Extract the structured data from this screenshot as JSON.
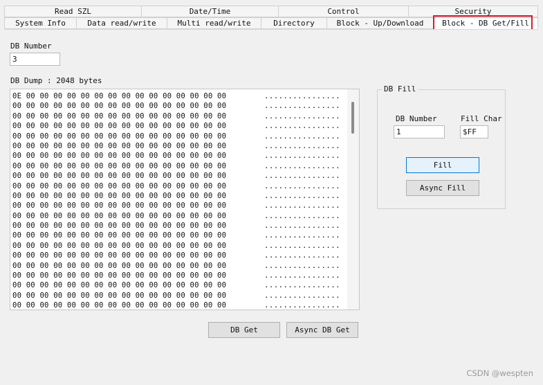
{
  "tabs_top": [
    "Read SZL",
    "Date/Time",
    "Control",
    "Security"
  ],
  "tabs_bottom": [
    "System Info",
    "Data read/write",
    "Multi read/write",
    "Directory",
    "Block - Up/Download",
    "Block - DB Get/Fill"
  ],
  "active_tab": "Block - DB Get/Fill",
  "highlight_color": "#e0162b",
  "db_number": {
    "label": "DB Number",
    "value": "3"
  },
  "dump": {
    "label": "DB Dump : 2048 bytes",
    "lines": [
      {
        "hex": "0E 00 00 00 00 00 00 00 00 00 00 00 00 00 00 00",
        "ascii": "................"
      },
      {
        "hex": "00 00 00 00 00 00 00 00 00 00 00 00 00 00 00 00",
        "ascii": "................"
      },
      {
        "hex": "00 00 00 00 00 00 00 00 00 00 00 00 00 00 00 00",
        "ascii": "................"
      },
      {
        "hex": "00 00 00 00 00 00 00 00 00 00 00 00 00 00 00 00",
        "ascii": "................"
      },
      {
        "hex": "00 00 00 00 00 00 00 00 00 00 00 00 00 00 00 00",
        "ascii": "................"
      },
      {
        "hex": "00 00 00 00 00 00 00 00 00 00 00 00 00 00 00 00",
        "ascii": "................"
      },
      {
        "hex": "00 00 00 00 00 00 00 00 00 00 00 00 00 00 00 00",
        "ascii": "................"
      },
      {
        "hex": "00 00 00 00 00 00 00 00 00 00 00 00 00 00 00 00",
        "ascii": "................"
      },
      {
        "hex": "00 00 00 00 00 00 00 00 00 00 00 00 00 00 00 00",
        "ascii": "................"
      },
      {
        "hex": "00 00 00 00 00 00 00 00 00 00 00 00 00 00 00 00",
        "ascii": "................"
      },
      {
        "hex": "00 00 00 00 00 00 00 00 00 00 00 00 00 00 00 00",
        "ascii": "................"
      },
      {
        "hex": "00 00 00 00 00 00 00 00 00 00 00 00 00 00 00 00",
        "ascii": "................"
      },
      {
        "hex": "00 00 00 00 00 00 00 00 00 00 00 00 00 00 00 00",
        "ascii": "................"
      },
      {
        "hex": "00 00 00 00 00 00 00 00 00 00 00 00 00 00 00 00",
        "ascii": "................"
      },
      {
        "hex": "00 00 00 00 00 00 00 00 00 00 00 00 00 00 00 00",
        "ascii": "................"
      },
      {
        "hex": "00 00 00 00 00 00 00 00 00 00 00 00 00 00 00 00",
        "ascii": "................"
      },
      {
        "hex": "00 00 00 00 00 00 00 00 00 00 00 00 00 00 00 00",
        "ascii": "................"
      },
      {
        "hex": "00 00 00 00 00 00 00 00 00 00 00 00 00 00 00 00",
        "ascii": "................"
      },
      {
        "hex": "00 00 00 00 00 00 00 00 00 00 00 00 00 00 00 00",
        "ascii": "................"
      },
      {
        "hex": "00 00 00 00 00 00 00 00 00 00 00 00 00 00 00 00",
        "ascii": "................"
      },
      {
        "hex": "00 00 00 00 00 00 00 00 00 00 00 00 00 00 00 00",
        "ascii": "................"
      },
      {
        "hex": "00 00 00 00 00 00 00 00 00 00 00 00 00 00 00 00",
        "ascii": "................"
      }
    ]
  },
  "db_fill": {
    "title": "DB Fill",
    "db_number_label": "DB Number",
    "db_number_value": "1",
    "fill_char_label": "Fill Char",
    "fill_char_value": "$FF",
    "fill_button": "Fill",
    "async_fill_button": "Async Fill"
  },
  "buttons": {
    "db_get": "DB Get",
    "async_db_get": "Async DB Get"
  },
  "watermark": "CSDN @wespten"
}
